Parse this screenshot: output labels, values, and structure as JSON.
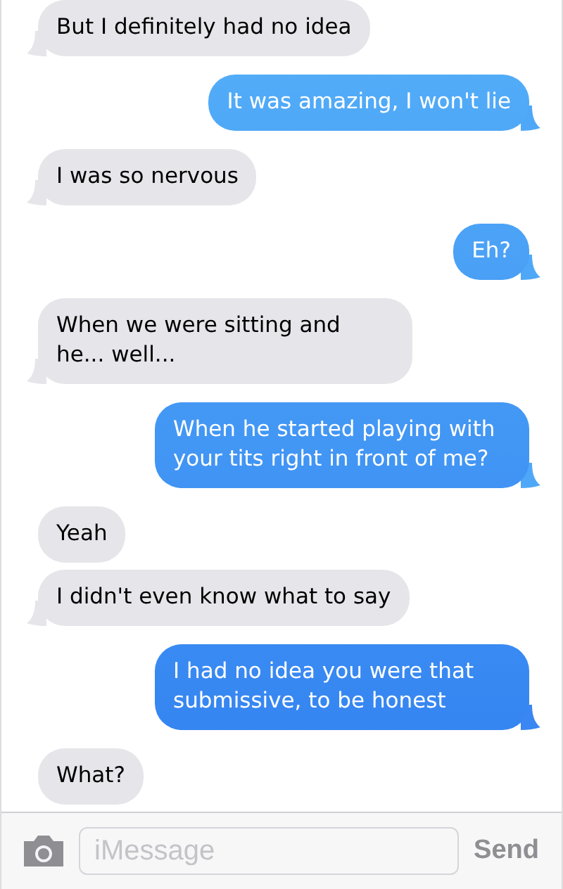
{
  "messages": [
    {
      "kind": "received",
      "text": "But I definitely had no idea",
      "tail": true
    },
    {
      "kind": "sent",
      "text": "It was amazing, I won't lie",
      "tail": true
    },
    {
      "kind": "received",
      "text": "I was so nervous",
      "tail": true
    },
    {
      "kind": "sent",
      "text": "Eh?",
      "tail": true
    },
    {
      "kind": "received",
      "text": "When we were sitting and he... well...",
      "tail": true
    },
    {
      "kind": "sent",
      "text": "When he started playing with your tits right in front of me?",
      "tail": true
    },
    {
      "kind": "received",
      "text": "Yeah",
      "tail": false
    },
    {
      "kind": "received",
      "text": "I didn't even know what to say",
      "tail": true
    },
    {
      "kind": "sent",
      "text": "I had no idea you were that submissive, to be honest",
      "tail": true
    },
    {
      "kind": "received",
      "text": "What?",
      "tail": false
    }
  ],
  "composer": {
    "placeholder": "iMessage",
    "send": "Send"
  }
}
